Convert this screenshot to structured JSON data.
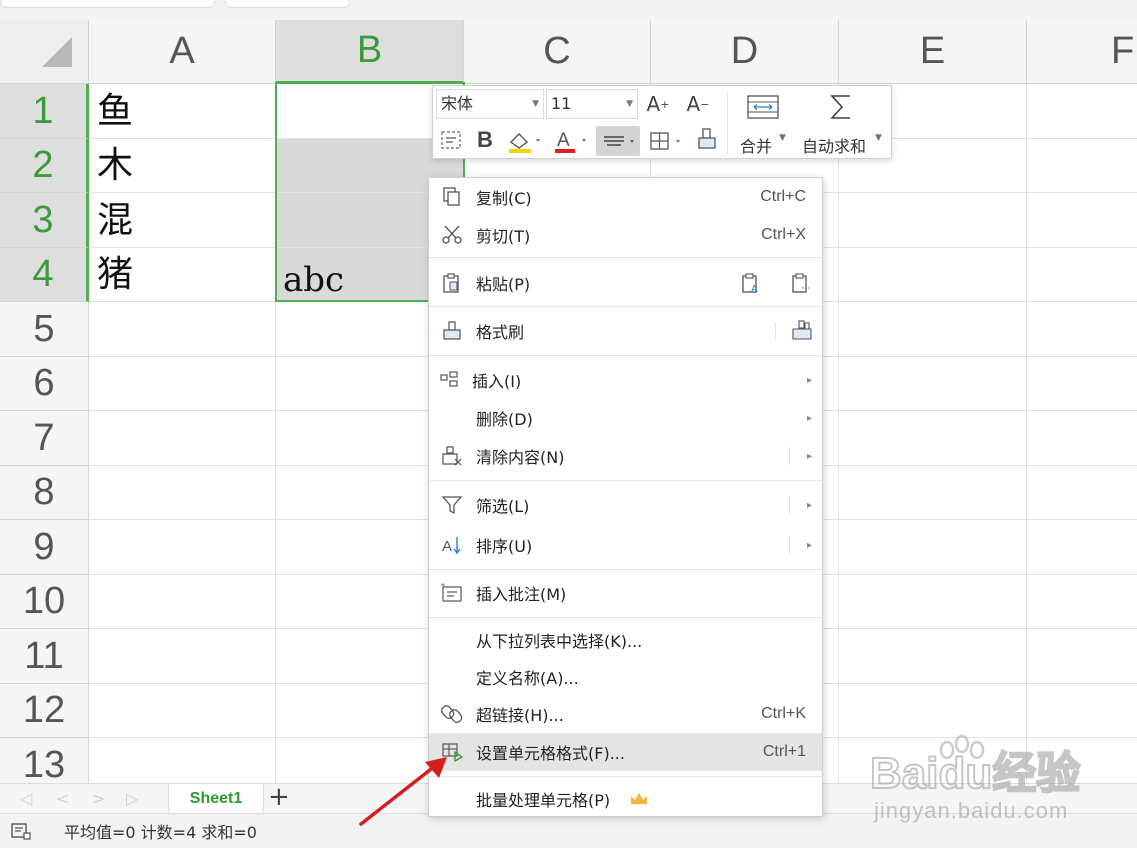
{
  "grid": {
    "columns": [
      "A",
      "B",
      "C",
      "D",
      "E",
      "F"
    ],
    "rows": [
      "1",
      "2",
      "3",
      "4",
      "5",
      "6",
      "7",
      "8",
      "9",
      "10",
      "11",
      "12",
      "13"
    ],
    "cells": {
      "A1": "鱼",
      "A2": "木",
      "A3": "混",
      "A4": "猪",
      "B4": "abc"
    },
    "selected_column": "B",
    "selected_rows": [
      "1",
      "2",
      "3",
      "4"
    ]
  },
  "mini_toolbar": {
    "font_name": "宋体",
    "font_size": "11",
    "bold_label": "B",
    "merge_label": "合并",
    "autosum_label": "自动求和"
  },
  "context_menu": {
    "items": [
      {
        "label": "复制(C)",
        "shortcut": "Ctrl+C",
        "icon": "copy-icon"
      },
      {
        "label": "剪切(T)",
        "shortcut": "Ctrl+X",
        "icon": "scissors-icon"
      },
      {
        "label": "粘贴(P)",
        "icon": "paste-icon"
      },
      {
        "label": "格式刷",
        "icon": "format-painter-icon"
      },
      {
        "label": "插入(I)",
        "icon": "insert-icon"
      },
      {
        "label": "删除(D)"
      },
      {
        "label": "清除内容(N)",
        "icon": "clear-icon"
      },
      {
        "label": "筛选(L)",
        "icon": "filter-icon"
      },
      {
        "label": "排序(U)",
        "icon": "sort-icon"
      },
      {
        "label": "插入批注(M)",
        "icon": "comment-icon"
      },
      {
        "label": "从下拉列表中选择(K)..."
      },
      {
        "label": "定义名称(A)..."
      },
      {
        "label": "超链接(H)...",
        "shortcut": "Ctrl+K",
        "icon": "link-icon"
      },
      {
        "label": "设置单元格格式(F)...",
        "shortcut": "Ctrl+1",
        "icon": "format-cells-icon",
        "highlighted": true
      },
      {
        "label": "批量处理单元格(P)",
        "icon": "crown-icon"
      }
    ]
  },
  "sheet_tabs": {
    "active": "Sheet1",
    "add_label": "+"
  },
  "status_bar": {
    "text": "平均值=0  计数=4  求和=0"
  },
  "watermark": {
    "logo_text": "Baidu经验",
    "url_text": "jingyan.baidu.com"
  },
  "colors": {
    "accent_green": "#4caf50",
    "selected_header_bg": "#dedede",
    "menu_highlight": "#e4e4e4",
    "arrow_red": "#d21e1e",
    "crown_gold": "#f5b23b"
  }
}
